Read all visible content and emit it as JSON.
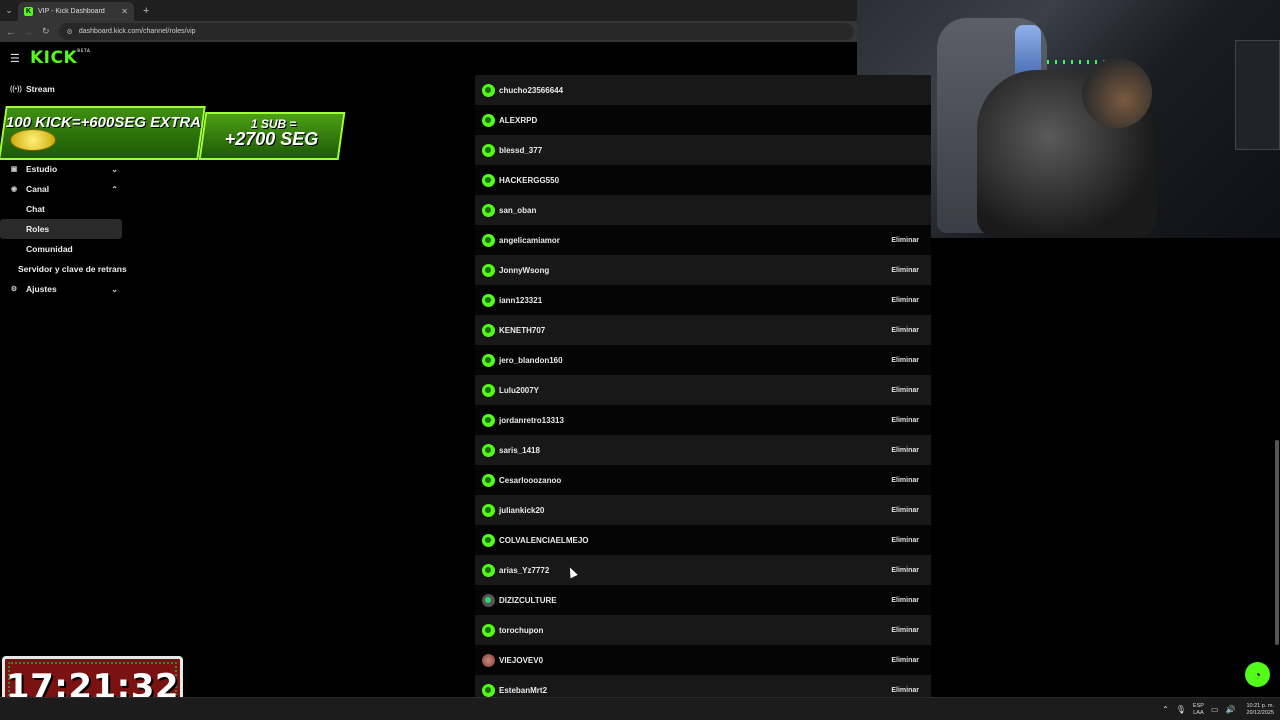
{
  "browser": {
    "tab_title": "VIP - Kick Dashboard",
    "tab_favicon": "K",
    "url": "dashboard.kick.com/channel/roles/vip"
  },
  "header": {
    "logo": "KICK",
    "logo_tm": "BETA"
  },
  "sidebar": {
    "items": [
      {
        "label": "Stream",
        "icon": "broadcast-icon"
      },
      {
        "label": "Estudio",
        "icon": "studio-icon",
        "chevron": "⌄"
      },
      {
        "label": "Canal",
        "icon": "channel-icon",
        "chevron": "⌃"
      },
      {
        "label": "Chat"
      },
      {
        "label": "Roles"
      },
      {
        "label": "Comunidad"
      },
      {
        "label": "Servidor y clave de retrans"
      },
      {
        "label": "Ajustes",
        "icon": "gear-icon",
        "chevron": "⌄"
      }
    ]
  },
  "overlay": {
    "promo_kick": "100 KICK=+600SEG EXTRA",
    "promo_sub_line1": "1 SUB =",
    "promo_sub_line2": "+2700 SEG",
    "clock": "17:21:32"
  },
  "vip": {
    "remove_label": "Eliminar",
    "users": [
      "chucho23566644",
      "ALEXRPD",
      "blessd_377",
      "HACKERGG550",
      "san_oban",
      "angelicamiamor",
      "JonnyWsong",
      "iann123321",
      "KENETH707",
      "jero_blandon160",
      "Lulu2007Y",
      "jordanretro13313",
      "saris_1418",
      "Cesarlooozanoo",
      "juliankick20",
      "COLVALENCIAELMEJO",
      "arias_Yz7772",
      "DIZIZCULTURE",
      "torochupon",
      "VIEJOVEV0",
      "EstebanMrt2"
    ]
  },
  "taskbar": {
    "lang_line1": "ESP",
    "lang_line2": "LAA",
    "time": "10:21 p. m.",
    "date": "20/12/2025"
  },
  "colors": {
    "accent": "#53fc18",
    "background": "#000000",
    "row_alt": "#181818"
  }
}
